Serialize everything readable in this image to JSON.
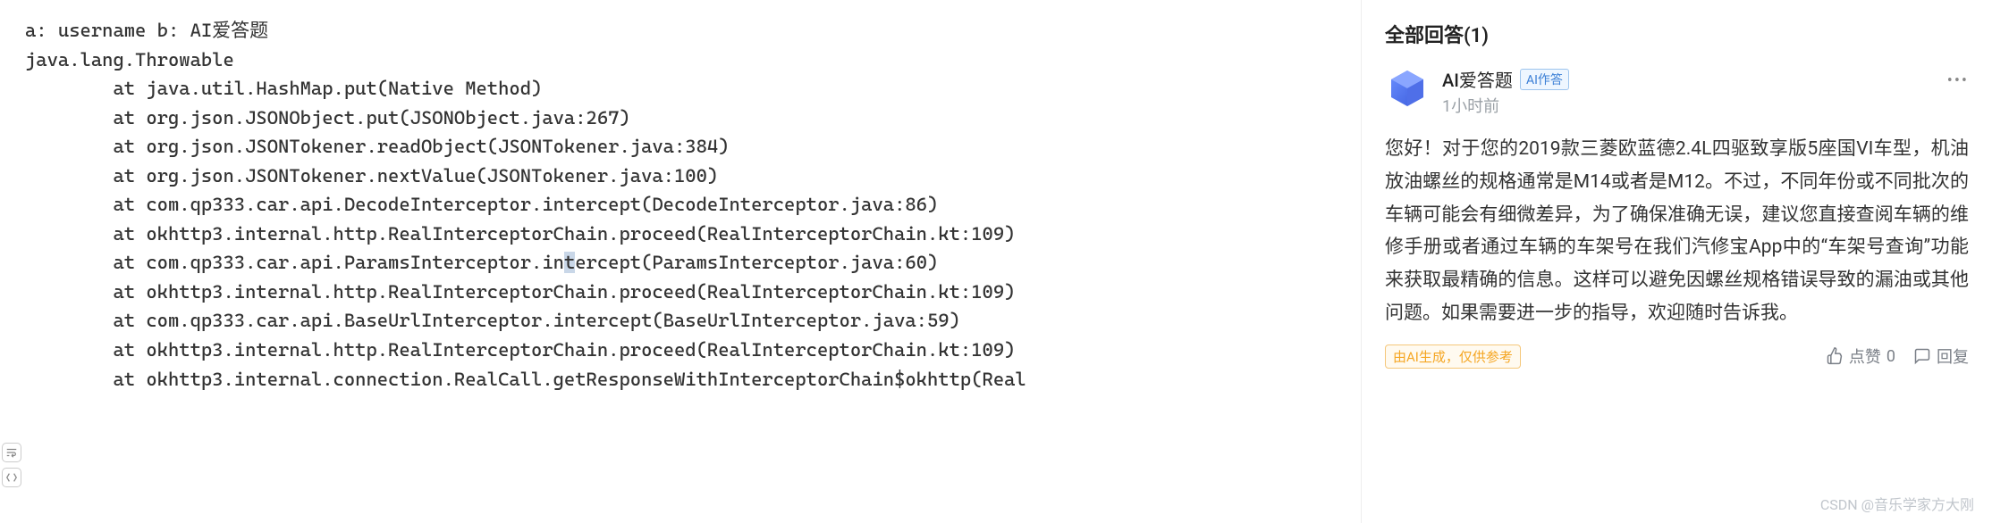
{
  "code": {
    "line1": "a: username b: AI爱答题",
    "line2": "java.lang.Throwable",
    "trace": [
      "        at java.util.HashMap.put(Native Method)",
      "        at org.json.JSONObject.put(JSONObject.java:267)",
      "        at org.json.JSONTokener.readObject(JSONTokener.java:384)",
      "        at org.json.JSONTokener.nextValue(JSONTokener.java:100)",
      "        at com.qp333.car.api.DecodeInterceptor.intercept(DecodeInterceptor.java:86)",
      "        at okhttp3.internal.http.RealInterceptorChain.proceed(RealInterceptorChain.kt:109)"
    ],
    "hl_pre": "        at com.qp333.car.api.ParamsInterceptor.in",
    "hl_char": "t",
    "hl_post": "ercept(ParamsInterceptor.java:60)",
    "trace2": [
      "        at okhttp3.internal.http.RealInterceptorChain.proceed(RealInterceptorChain.kt:109)",
      "        at com.qp333.car.api.BaseUrlInterceptor.intercept(BaseUrlInterceptor.java:59)",
      "        at okhttp3.internal.http.RealInterceptorChain.proceed(RealInterceptorChain.kt:109)",
      "        at okhttp3.internal.connection.RealCall.getResponseWithInterceptorChain$okhttp(Real"
    ]
  },
  "answers": {
    "header": "全部回答(1)",
    "item": {
      "author": "AI爱答题",
      "badge": "AI作答",
      "time": "1小时前",
      "more": "•••",
      "body": "您好！对于您的2019款三菱欧蓝德2.4L四驱致享版5座国VI车型，机油放油螺丝的规格通常是M14或者是M12。不过，不同年份或不同批次的车辆可能会有细微差异，为了确保准确无误，建议您直接查阅车辆的维修手册或者通过车辆的车架号在我们汽修宝App中的“车架号查询”功能来获取最精确的信息。这样可以避免因螺丝规格错误导致的漏油或其他问题。如果需要进一步的指导，欢迎随时告诉我。",
      "disclaimer": "由AI生成，仅供参考",
      "like_label": "点赞",
      "like_count": "0",
      "reply_label": "回复"
    }
  },
  "watermark": "CSDN @音乐学家方大刚"
}
